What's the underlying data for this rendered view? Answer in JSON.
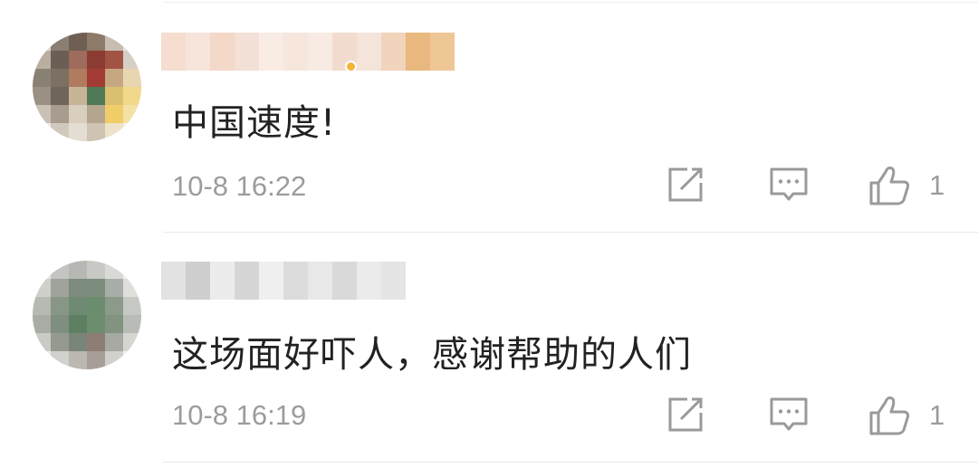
{
  "comments": [
    {
      "text": "中国速度!",
      "time": "10-8 16:22",
      "like_count": "1",
      "actions": {
        "forward_icon": "forward-icon",
        "reply_icon": "comment-icon",
        "like_icon": "thumbs-up-icon"
      },
      "avatar_pixels": [
        "#dcd6cf",
        "#8a7f72",
        "#6e5f52",
        "#8d7a68",
        "#c7bdb2",
        "#e5e0da",
        "#b9ae9f",
        "#6b5f55",
        "#9e6b5c",
        "#8c3b33",
        "#a15344",
        "#d7cfc6",
        "#8a8175",
        "#7d6f62",
        "#b07b5f",
        "#a13b34",
        "#c7a781",
        "#e8d6b0",
        "#9a9083",
        "#6f655a",
        "#c7b497",
        "#4f7a55",
        "#d8c070",
        "#f2d88a",
        "#c9c1b6",
        "#a79c8e",
        "#d9cfbf",
        "#b3a58e",
        "#f0cd68",
        "#f5e1a6",
        "#ece8e3",
        "#d2c9bd",
        "#e4ddd3",
        "#cfc4b3",
        "#eee3c8",
        "#f4efe6"
      ],
      "username_pixels": [
        "#f5ddd0",
        "#f7e4da",
        "#f4d8c8",
        "#f3e0d6",
        "#f8ece5",
        "#f6e6dc",
        "#f7ebe3",
        "#f2dccf",
        "#f5e4da",
        "#f0d4bc",
        "#e9b87e",
        "#efc796"
      ]
    },
    {
      "text": "这场面好吓人，感谢帮助的人们",
      "time": "10-8 16:19",
      "like_count": "1",
      "actions": {
        "forward_icon": "forward-icon",
        "reply_icon": "comment-icon",
        "like_icon": "thumbs-up-icon"
      },
      "avatar_pixels": [
        "#e6e6e3",
        "#c4c5c0",
        "#b7b8b3",
        "#c8c9c4",
        "#d9dad6",
        "#eeeeec",
        "#cfd0cb",
        "#9fa39c",
        "#7d8a7e",
        "#7c8c7d",
        "#a9ada7",
        "#dedfdb",
        "#b7b9b3",
        "#889686",
        "#6f8a72",
        "#6c8c6e",
        "#8b9a8a",
        "#c6c8c3",
        "#a8aca5",
        "#7e8f7f",
        "#5f7f62",
        "#6d8d6f",
        "#82937f",
        "#b9bbb6",
        "#c9cbc6",
        "#96998f",
        "#7a857a",
        "#8e7d74",
        "#a7aaa2",
        "#d5d6d2",
        "#ebebe9",
        "#d1d2cd",
        "#bcb7b1",
        "#a89e98",
        "#d0d1cc",
        "#f1f1ef"
      ],
      "username_pixels": [
        "#e2e2e2",
        "#cfcfcf",
        "#ececec",
        "#d6d6d6",
        "#f0f0f0",
        "#dcdcdc",
        "#e8e8e8",
        "#d9d9d9",
        "#ebebeb",
        "#e5e5e5"
      ]
    }
  ]
}
